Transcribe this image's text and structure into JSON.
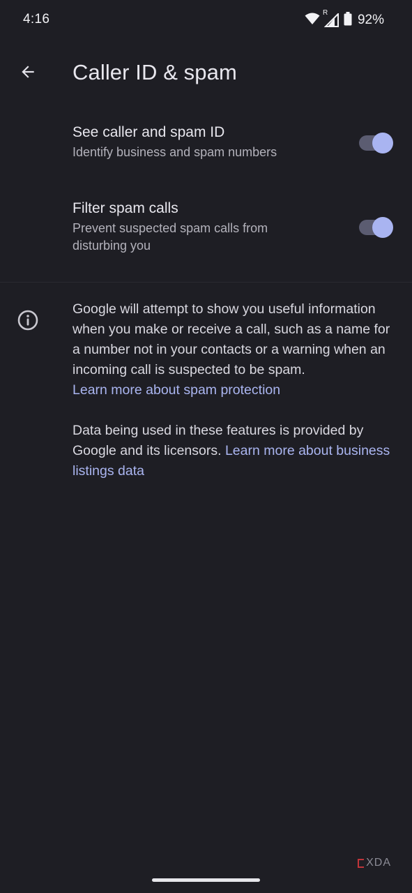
{
  "status_bar": {
    "time": "4:16",
    "roaming_indicator": "R",
    "battery_percent": "92%",
    "icons": [
      "wifi-icon",
      "signal-icon",
      "battery-icon"
    ]
  },
  "app_bar": {
    "back_icon": "arrow-back-icon",
    "title": "Caller ID & spam"
  },
  "settings": [
    {
      "title": "See caller and spam ID",
      "subtitle": "Identify business and spam numbers",
      "enabled": true
    },
    {
      "title": "Filter spam calls",
      "subtitle": "Prevent suspected spam calls from disturbing you",
      "enabled": true
    }
  ],
  "info": {
    "icon": "info-icon",
    "paragraph1": "Google will attempt to show you useful information when you make or receive a call, such as a name for a number not in your contacts or a warning when an incoming call is suspected to be spam.",
    "link1": "Learn more about spam protection",
    "paragraph2": "Data being used in these features is provided by Google and its licensors.",
    "link2": "Learn more about business listings data"
  },
  "watermark": {
    "text": "XDA"
  },
  "colors": {
    "background": "#1e1e24",
    "accent": "#a9b4f1",
    "link": "#aab5f0",
    "switch_track": "#5b5c71"
  }
}
